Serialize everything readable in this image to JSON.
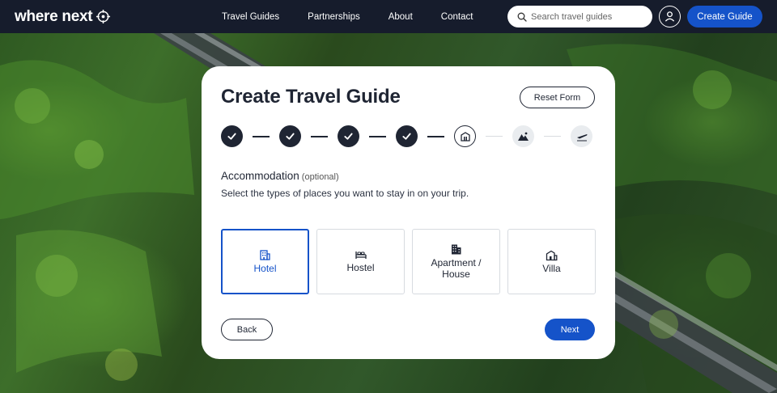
{
  "nav": {
    "logo_text": "where next",
    "links": [
      "Travel Guides",
      "Partnerships",
      "About",
      "Contact"
    ],
    "search_placeholder": "Search travel guides",
    "create_label": "Create Guide"
  },
  "form": {
    "title": "Create Travel Guide",
    "reset_label": "Reset Form",
    "steps": [
      {
        "status": "complete",
        "icon": "check-icon"
      },
      {
        "status": "complete",
        "icon": "check-icon"
      },
      {
        "status": "complete",
        "icon": "check-icon"
      },
      {
        "status": "complete",
        "icon": "check-icon"
      },
      {
        "status": "current",
        "icon": "accommodation-icon"
      },
      {
        "status": "upcoming",
        "icon": "activities-icon"
      },
      {
        "status": "upcoming",
        "icon": "flight-icon"
      }
    ],
    "section_title": "Accommodation",
    "section_optional": "(optional)",
    "section_description": "Select the types of places you want to stay in on your trip.",
    "options": [
      {
        "label": "Hotel",
        "icon": "hotel-icon",
        "selected": true
      },
      {
        "label": "Hostel",
        "icon": "bed-icon",
        "selected": false
      },
      {
        "label": "Apartment / House",
        "icon": "apartment-icon",
        "selected": false
      },
      {
        "label": "Villa",
        "icon": "villa-icon",
        "selected": false
      }
    ],
    "back_label": "Back",
    "next_label": "Next"
  },
  "colors": {
    "nav_bg": "#161c2c",
    "accent": "#1553c9",
    "text_dark": "#1f2533"
  }
}
